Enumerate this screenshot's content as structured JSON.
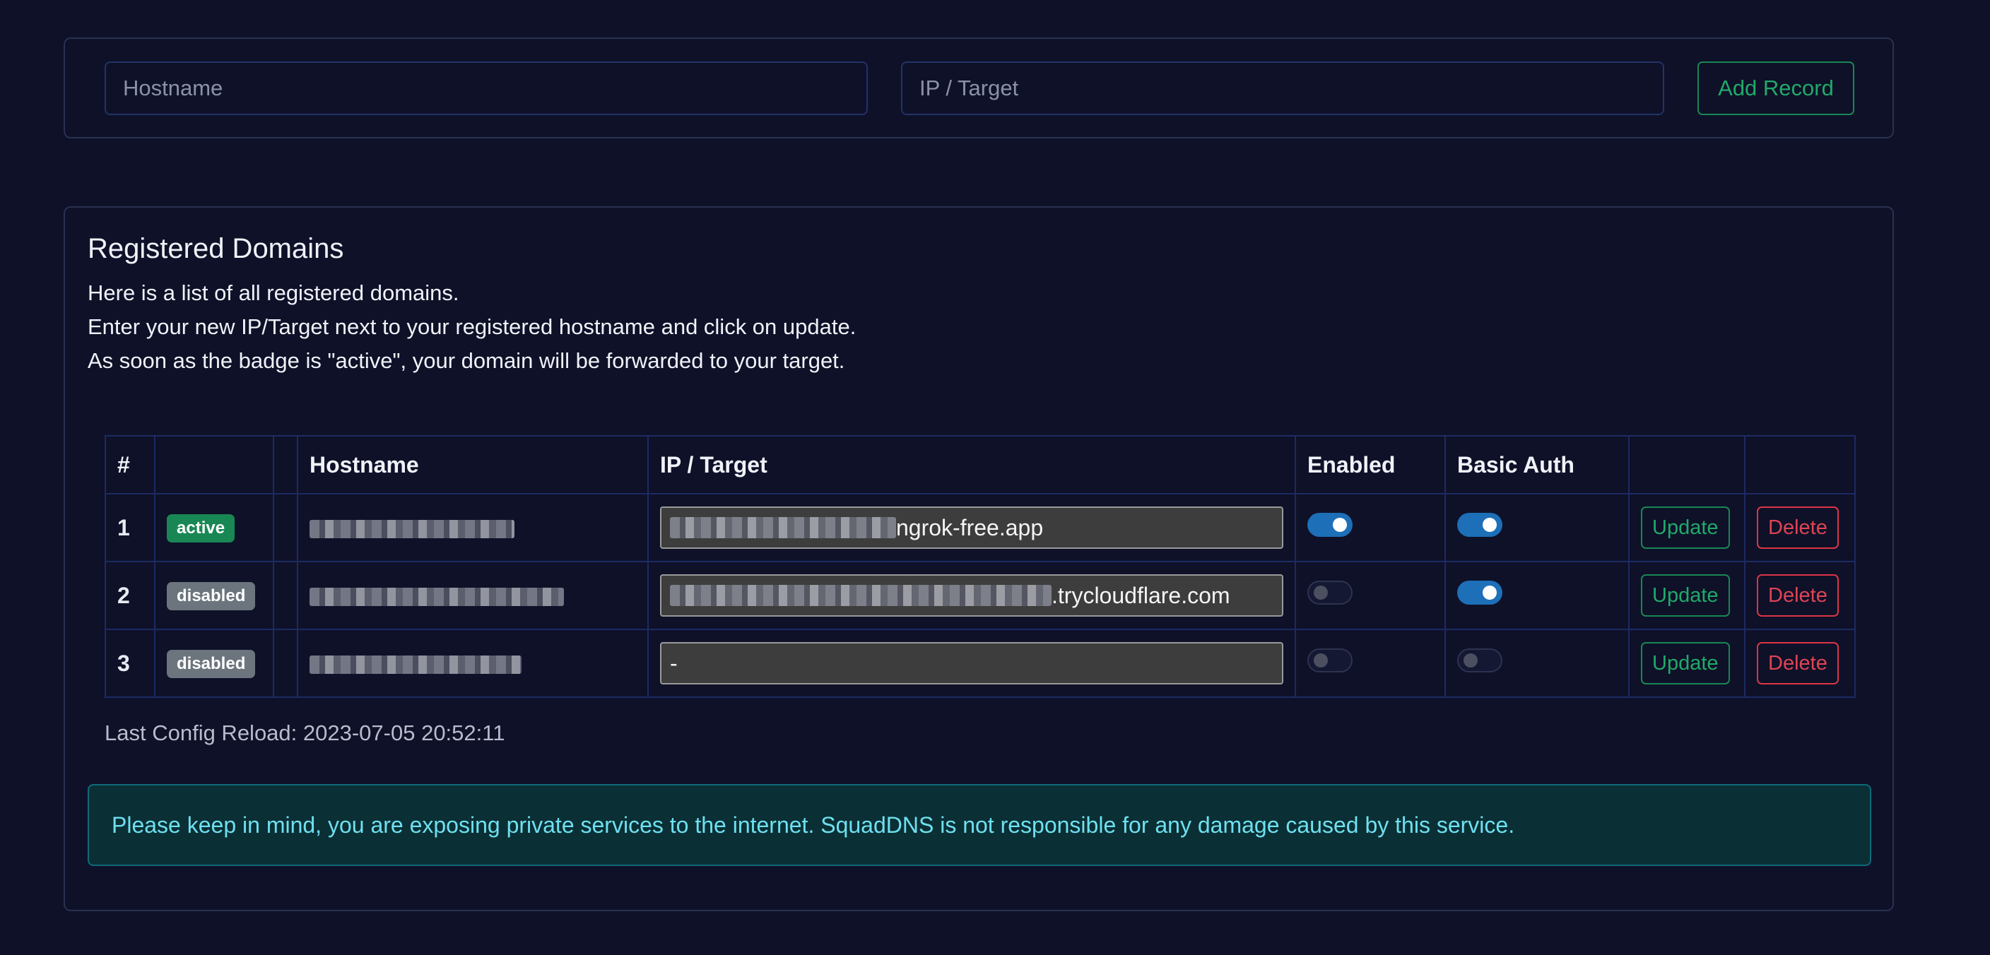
{
  "add_form": {
    "hostname_placeholder": "Hostname",
    "target_placeholder": "IP / Target",
    "add_button_label": "Add Record"
  },
  "domains_section": {
    "title": "Registered Domains",
    "description": [
      "Here is a list of all registered domains.",
      "Enter your new IP/Target next to your registered hostname and click on update.",
      "As soon as the badge is \"active\", your domain will be forwarded to your target."
    ],
    "table": {
      "headers": [
        "#",
        "",
        "",
        "Hostname",
        "IP / Target",
        "Enabled",
        "Basic Auth",
        "",
        ""
      ],
      "rows": [
        {
          "num": "1",
          "badge": "active",
          "target_visible": "ngrok-free.app",
          "enabled": true,
          "basic_auth": true,
          "update_label": "Update",
          "delete_label": "Delete"
        },
        {
          "num": "2",
          "badge": "disabled",
          "target_visible": ".trycloudflare.com",
          "enabled": false,
          "basic_auth": true,
          "update_label": "Update",
          "delete_label": "Delete"
        },
        {
          "num": "3",
          "badge": "disabled",
          "target_visible": "-",
          "enabled": false,
          "basic_auth": false,
          "update_label": "Update",
          "delete_label": "Delete"
        }
      ]
    },
    "last_reload": "Last Config Reload: 2023-07-05 20:52:11",
    "warning": "Please keep in mind, you are exposing private services to the internet. SquadDNS is not responsible for any damage caused by this service."
  },
  "colors": {
    "background": "#0e1128",
    "success": "#198754",
    "danger": "#dc3545",
    "toggle_on": "#1d6fb8",
    "info_bg": "#0a2f35",
    "info_text": "#6ee0ef"
  }
}
